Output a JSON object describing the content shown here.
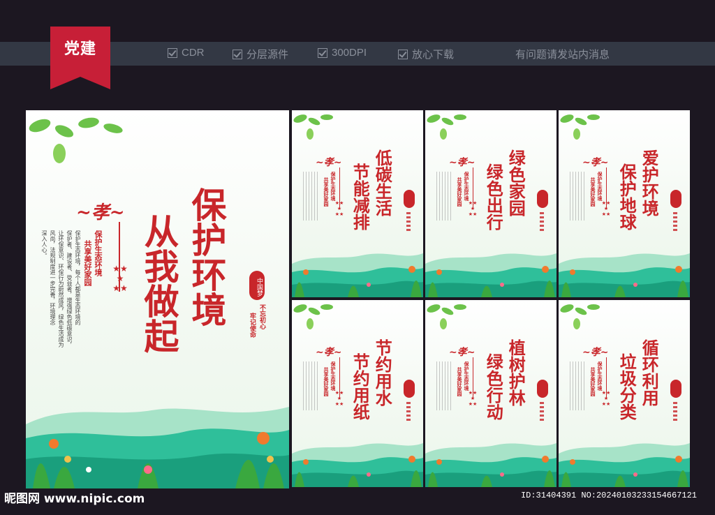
{
  "header": {
    "badge": "党建",
    "features": [
      "CDR",
      "分层源件",
      "300DPI",
      "放心下载"
    ],
    "notice": "有问题请发站内消息"
  },
  "main_poster": {
    "title_col1": "保护环境",
    "title_col2": "从我做起",
    "slogan_col1": "保护生态环境",
    "slogan_col2": "共享美好家园",
    "body_cols": [
      "保护生态环境，每个人都是生态环境的",
      "保护者、建设者、受益者，增强绿色低碳意识，",
      "让环保意识、环保行为蔚然成风，绿色生活成为",
      "风尚，法规制度进一步完善，环境理念",
      "深入人心。"
    ],
    "tagline_col1": "不忘初心",
    "tagline_col2": "牢记使命",
    "seal_text": "中国梦"
  },
  "small_posters": [
    {
      "title_col1": "低碳生活",
      "title_col2": "节能减排",
      "slogan_col1": "保护生态环境",
      "slogan_col2": "共享美好家园"
    },
    {
      "title_col1": "绿色家园",
      "title_col2": "绿色出行",
      "slogan_col1": "保护生态环境",
      "slogan_col2": "共享美好家园"
    },
    {
      "title_col1": "爱护环境",
      "title_col2": "保护地球",
      "slogan_col1": "保护生态环境",
      "slogan_col2": "共享美好家园"
    },
    {
      "title_col1": "节约用水",
      "title_col2": "节约用纸",
      "slogan_col1": "保护生态环境",
      "slogan_col2": "共享美好家园"
    },
    {
      "title_col1": "植树护林",
      "title_col2": "绿色行动",
      "slogan_col1": "保护生态环境",
      "slogan_col2": "共享美好家园"
    },
    {
      "title_col1": "循环利用",
      "title_col2": "垃圾分类",
      "slogan_col1": "保护生态环境",
      "slogan_col2": "共享美好家园"
    }
  ],
  "footer": {
    "site": "昵图网 www.nipic.com",
    "id_text": "ID:31404391 NO:20240103233154667121"
  },
  "colors": {
    "accent_red": "#c8262a",
    "hill_green": "#2fbf9a",
    "leaf_green": "#6cc24a"
  }
}
